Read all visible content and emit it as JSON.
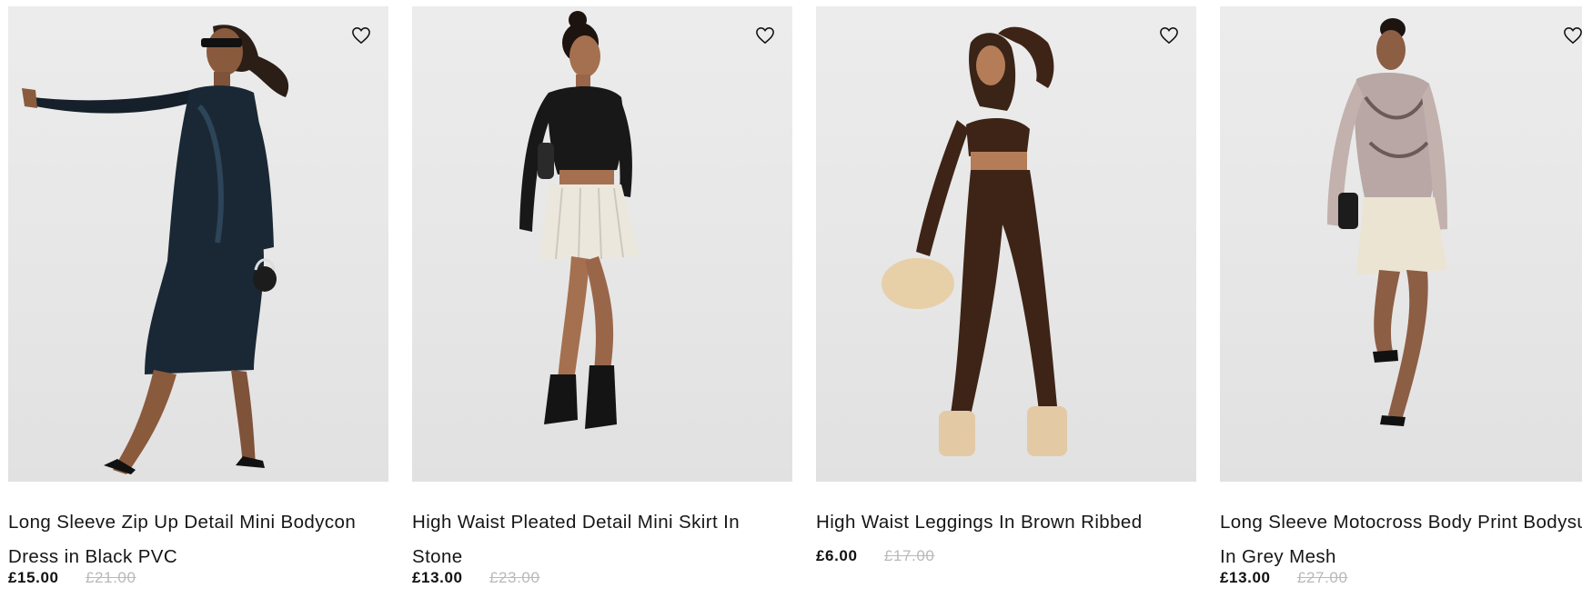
{
  "products": [
    {
      "name": "Long Sleeve Zip Up Detail Mini Bodycon Dress in Black PVC",
      "price": "£15.00",
      "original_price": "£21.00",
      "wishlist_icon": "heart-outline-icon"
    },
    {
      "name": "High Waist Pleated Detail Mini Skirt In Stone",
      "price": "£13.00",
      "original_price": "£23.00",
      "wishlist_icon": "heart-outline-icon"
    },
    {
      "name": "High Waist Leggings In Brown Ribbed",
      "price": "£6.00",
      "original_price": "£17.00",
      "wishlist_icon": "heart-outline-icon"
    },
    {
      "name": "Long Sleeve Motocross Body Print Bodysuit In Grey Mesh",
      "price": "£13.00",
      "original_price": "£27.00",
      "wishlist_icon": "heart-outline-icon"
    }
  ],
  "colors": {
    "price": "#111111",
    "original_price": "#b9b9b9",
    "image_background": "#e8e8e8"
  }
}
